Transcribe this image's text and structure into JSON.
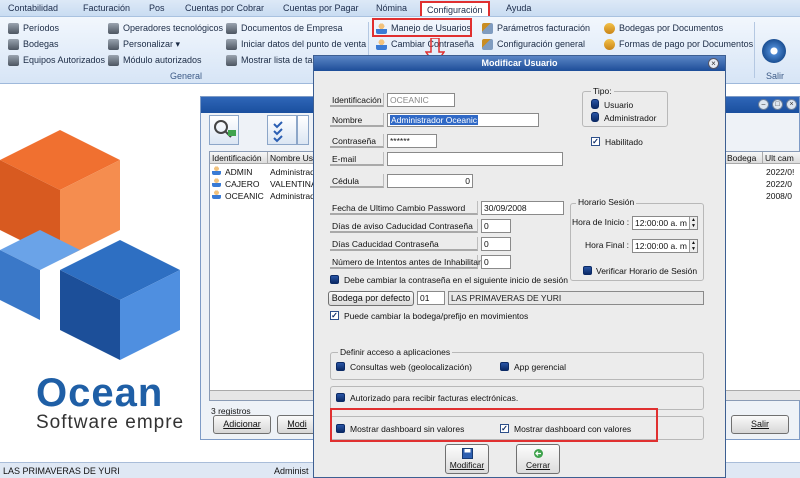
{
  "menu": {
    "items": [
      "Contabilidad",
      "Facturación",
      "Pos",
      "Cuentas por Cobrar",
      "Cuentas por Pagar",
      "Nómina",
      "Configuración",
      "Ayuda"
    ],
    "active": "Configuración"
  },
  "ribbon": {
    "col1": [
      "Períodos",
      "Bodegas",
      "Equipos Autorizados"
    ],
    "col2": [
      "Operadores tecnológicos",
      "Personalizar ▾",
      "Módulo autorizados"
    ],
    "col3": [
      "Documentos de Empresa",
      "Iniciar datos del punto de venta",
      "Mostrar lista de tar"
    ],
    "col4": [
      "Manejo de Usuarios",
      "Cambiar Contraseña"
    ],
    "col5": [
      "Parámetros facturación",
      "Configuración general"
    ],
    "col6": [
      "Bodegas por Documentos",
      "Formas de pago por Documentos"
    ],
    "group_general": "General",
    "group_salir": "Salir"
  },
  "logo": {
    "name": "Ocean",
    "tagline": "Software empre"
  },
  "status": {
    "left": "LAS PRIMAVERAS DE YURI",
    "mid": "Administ"
  },
  "user_list": {
    "columns": [
      "Identificación",
      "Nombre Usu",
      "Bodega",
      "Ult cam"
    ],
    "rows": [
      {
        "id": "ADMIN",
        "name": "Administrad",
        "date": "2022/0!"
      },
      {
        "id": "CAJERO",
        "name": "VALENTINA",
        "date": "2022/0"
      },
      {
        "id": "OCEANIC",
        "name": "Administrad",
        "date": "2008/0"
      }
    ],
    "count": "3 registros",
    "btn_add": "Adicionar",
    "btn_mod": "Modi",
    "btn_exit": "Salir"
  },
  "dialog": {
    "title": "Modificar Usuario",
    "identificacion_label": "Identificación",
    "identificacion_value": "OCEANIC",
    "nombre_label": "Nombre",
    "nombre_value": "Administrador Oceanic",
    "contrasena_label": "Contraseña",
    "contrasena_value": "******",
    "email_label": "E-mail",
    "email_value": "",
    "cedula_label": "Cédula",
    "cedula_value": "0",
    "tipo_label": "Tipo:",
    "tipo_usuario": "Usuario",
    "tipo_admin": "Administrador",
    "habilitado": "Habilitado",
    "fecha_label": "Fecha de Ultimo Cambio Password",
    "fecha_value": "30/09/2008",
    "dias_aviso_label": "Días de aviso Caducidad Contraseña",
    "dias_aviso_value": "0",
    "dias_cad_label": "Días Caducidad Contraseña",
    "dias_cad_value": "0",
    "intentos_label": "Número de Intentos antes de Inhabilitar",
    "intentos_value": "0",
    "horario_label": "Horario Sesión",
    "hora_inicio_label": "Hora de Inicio :",
    "hora_inicio_value": "12:00:00 a. m",
    "hora_final_label": "Hora Final :",
    "hora_final_value": "12:00:00 a. m",
    "verificar_horario": "Verificar Horario de Sesión",
    "debe_cambiar": "Debe cambiar la contraseña en el siguiente inicio de sesión",
    "bodega_btn": "Bodega por defecto",
    "bodega_code": "01",
    "bodega_name": "LAS PRIMAVERAS DE YURI",
    "puede_cambiar": "Puede cambiar la bodega/prefijo en movimientos",
    "acceso_label": "Definir acceso a aplicaciones",
    "consultas_web": "Consultas web (geolocalización)",
    "app_gerencial": "App gerencial",
    "autorizado": "Autorizado para recibir facturas electrónicas.",
    "dash_sin": "Mostrar dashboard sin valores",
    "dash_con": "Mostrar dashboard con valores",
    "btn_modificar": "Modificar",
    "btn_cerrar": "Cerrar"
  }
}
